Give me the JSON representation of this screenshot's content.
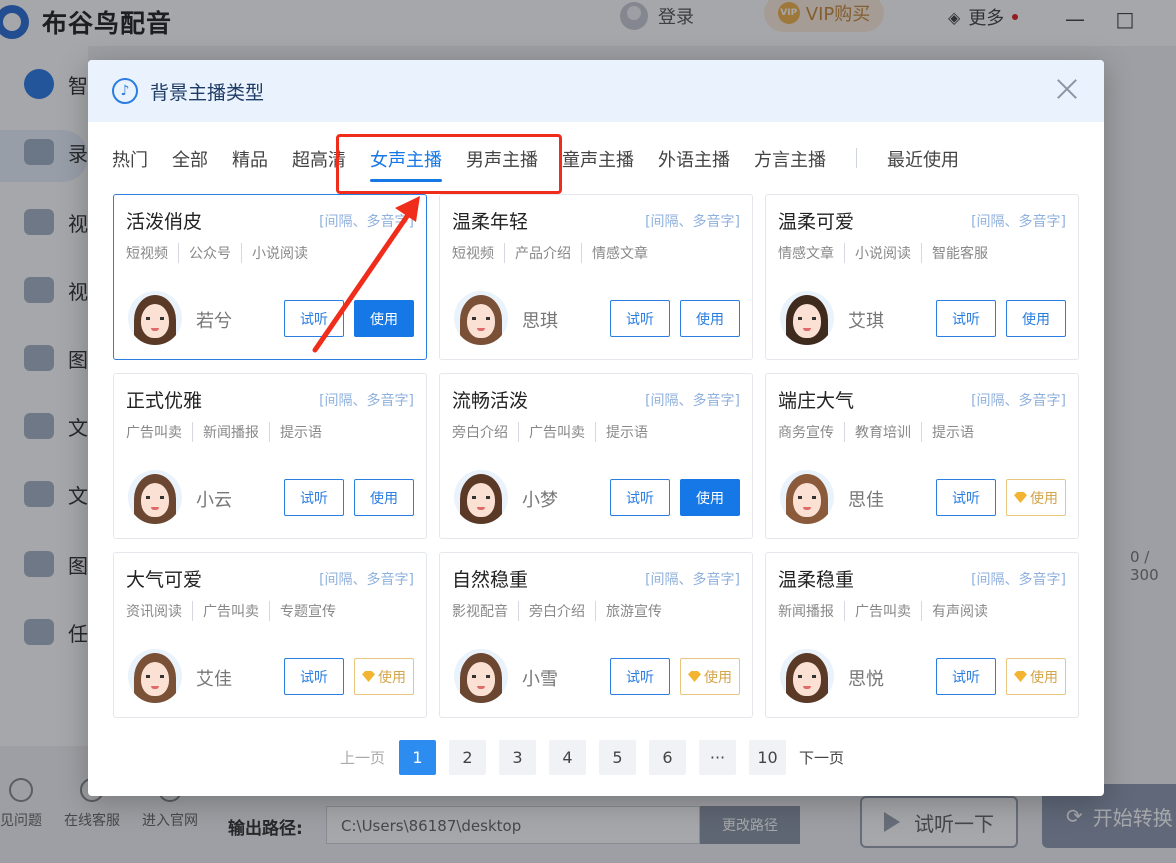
{
  "app": {
    "name": "布谷鸟配音",
    "login_label": "登录",
    "vip_label": "VIP购买",
    "vip_badge": "",
    "more_label": "更多",
    "minimize": "—",
    "maximize": "□",
    "sidebar": [
      {
        "label": "智",
        "icon": "ai-icon"
      },
      {
        "label": "录",
        "icon": "record-icon"
      },
      {
        "label": "视",
        "icon": "video-icon"
      },
      {
        "label": "视",
        "icon": "video-voice-icon"
      },
      {
        "label": "图",
        "icon": "image-translate-icon"
      },
      {
        "label": "文",
        "icon": "text-translate-icon"
      },
      {
        "label": "文",
        "icon": "doc-translate-icon"
      },
      {
        "label": "图",
        "icon": "image-icon"
      },
      {
        "label": "任",
        "icon": "task-icon"
      }
    ],
    "footer": [
      "见问题",
      "在线客服",
      "进入官网"
    ],
    "output_label": "输出路径:",
    "output_path": "C:\\Users\\86187\\desktop",
    "change_path": "更改路径",
    "try_listen": "试听一下",
    "start_convert": "开始转换",
    "char_count": "0 / 300"
  },
  "modal": {
    "title": "背景主播类型",
    "tabs": [
      "热门",
      "全部",
      "精品",
      "超高清",
      "女声主播",
      "男声主播",
      "童声主播",
      "外语主播",
      "方言主播",
      "最近使用"
    ],
    "active_tab": "女声主播",
    "hint": "[间隔、多音字]",
    "listen_label": "试听",
    "use_label": "使用",
    "cards": [
      {
        "title": "活泼俏皮",
        "tags": [
          "短视频",
          "公众号",
          "小说阅读"
        ],
        "voice": "若兮",
        "use_style": "primary",
        "selected": true
      },
      {
        "title": "温柔年轻",
        "tags": [
          "短视频",
          "产品介绍",
          "情感文章"
        ],
        "voice": "思琪",
        "use_style": "outline",
        "selected": false
      },
      {
        "title": "温柔可爱",
        "tags": [
          "情感文章",
          "小说阅读",
          "智能客服"
        ],
        "voice": "艾琪",
        "use_style": "outline",
        "selected": false
      },
      {
        "title": "正式优雅",
        "tags": [
          "广告叫卖",
          "新闻播报",
          "提示语"
        ],
        "voice": "小云",
        "use_style": "outline",
        "selected": false
      },
      {
        "title": "流畅活泼",
        "tags": [
          "旁白介绍",
          "广告叫卖",
          "提示语"
        ],
        "voice": "小梦",
        "use_style": "primary",
        "selected": false
      },
      {
        "title": "端庄大气",
        "tags": [
          "商务宣传",
          "教育培训",
          "提示语"
        ],
        "voice": "思佳",
        "use_style": "vip",
        "selected": false
      },
      {
        "title": "大气可爱",
        "tags": [
          "资讯阅读",
          "广告叫卖",
          "专题宣传"
        ],
        "voice": "艾佳",
        "use_style": "vip",
        "selected": false
      },
      {
        "title": "自然稳重",
        "tags": [
          "影视配音",
          "旁白介绍",
          "旅游宣传"
        ],
        "voice": "小雪",
        "use_style": "vip",
        "selected": false
      },
      {
        "title": "温柔稳重",
        "tags": [
          "新闻播报",
          "广告叫卖",
          "有声阅读"
        ],
        "voice": "思悦",
        "use_style": "vip",
        "selected": false
      }
    ],
    "pager": {
      "prev": "上一页",
      "next": "下一页",
      "pages": [
        "1",
        "2",
        "3",
        "4",
        "5",
        "6",
        "···",
        "10"
      ],
      "current": "1"
    }
  },
  "colors": {
    "accent": "#1677e6",
    "highlight": "#f02d1b",
    "vip": "#d4a54a"
  }
}
